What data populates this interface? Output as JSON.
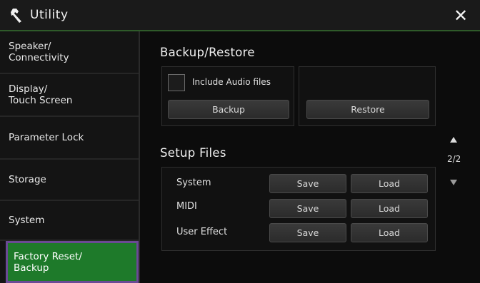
{
  "header": {
    "title": "Utility",
    "close_label": "✕"
  },
  "sidebar": {
    "items": [
      {
        "label": "Speaker/\nConnectivity"
      },
      {
        "label": "Display/\nTouch Screen"
      },
      {
        "label": "Parameter Lock"
      },
      {
        "label": "Storage"
      },
      {
        "label": "System"
      },
      {
        "label": "Factory Reset/\nBackup",
        "active": true
      }
    ]
  },
  "backup_restore": {
    "title": "Backup/Restore",
    "include_audio_label": "Include Audio files",
    "include_audio_checked": false,
    "backup_label": "Backup",
    "restore_label": "Restore"
  },
  "setup_files": {
    "title": "Setup Files",
    "rows": [
      {
        "label": "System",
        "save": "Save",
        "load": "Load"
      },
      {
        "label": "MIDI",
        "save": "Save",
        "load": "Load"
      },
      {
        "label": "User Effect",
        "save": "Save",
        "load": "Load"
      }
    ]
  },
  "pager": {
    "page": "2/2"
  },
  "colors": {
    "accent_green": "#1e7a2a",
    "active_border": "#6a4a95",
    "title_underline": "#2f5b2a"
  }
}
